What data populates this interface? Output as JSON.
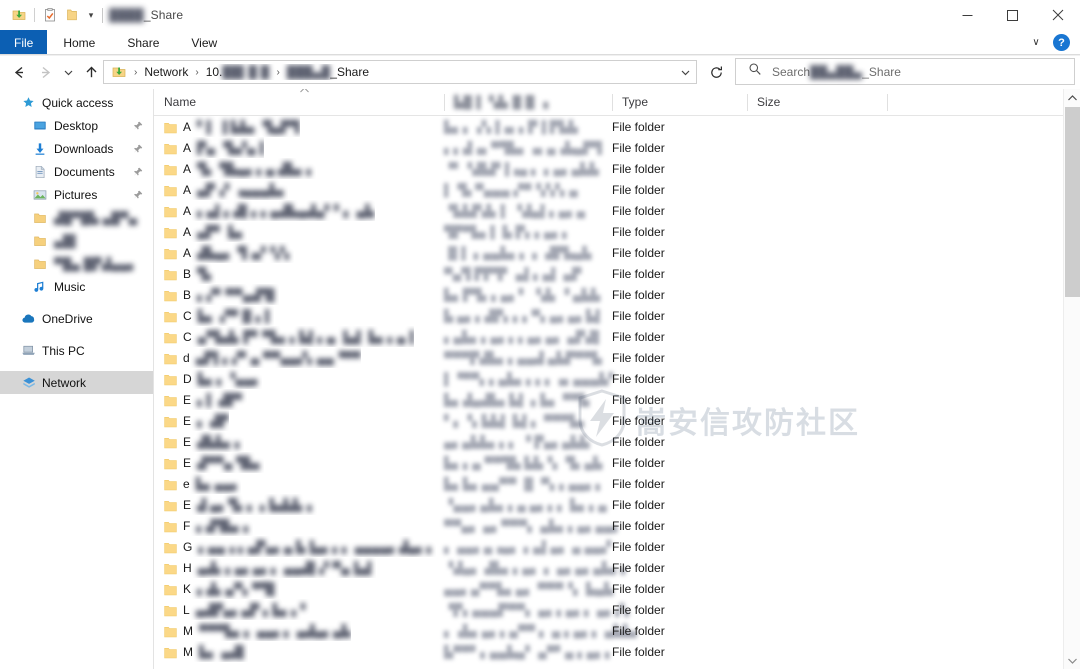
{
  "window": {
    "title_blurred": "████",
    "title_suffix": "_Share",
    "quick_access_toolbar": [
      {
        "name": "folder-download-icon",
        "label": ""
      },
      {
        "name": "properties-icon",
        "label": ""
      },
      {
        "name": "new-folder-icon",
        "label": ""
      },
      {
        "name": "customize-caret-icon",
        "label": "▾"
      }
    ],
    "controls": {
      "minimize": "—",
      "maximize": "□",
      "close": "✕"
    }
  },
  "ribbon": {
    "tabs": [
      {
        "label": "File",
        "active": true
      },
      {
        "label": "Home",
        "active": false
      },
      {
        "label": "Share",
        "active": false
      },
      {
        "label": "View",
        "active": false
      }
    ],
    "expand_caret": "∨",
    "help_label": "?"
  },
  "navbar": {
    "back": "←",
    "forward": "→",
    "recent_caret": "∨",
    "up": "↑",
    "address_caret": "∨",
    "refresh": "↻",
    "breadcrumbs": [
      {
        "label": "",
        "icon": "folder-download-icon",
        "blurred": false
      },
      {
        "label": "Network",
        "blurred": false
      },
      {
        "label": "10.",
        "blurred_tail": "██▌█ █",
        "blurred": true
      },
      {
        "label": "_Share",
        "blurred_head": "███▄█",
        "blurred": true
      }
    ],
    "separator": "›"
  },
  "search": {
    "icon": "search-icon",
    "placeholder_prefix": "Search ",
    "placeholder_blurred": "██▄██▄",
    "placeholder_suffix": "_Share"
  },
  "sidebar": {
    "items": [
      {
        "label": "Quick access",
        "icon": "pin-star-icon",
        "level": "root",
        "pinned": false,
        "selected": false,
        "blurred": false
      },
      {
        "label": "Desktop",
        "icon": "desktop-icon",
        "level": "child",
        "pinned": true,
        "selected": false,
        "blurred": false
      },
      {
        "label": "Downloads",
        "icon": "downloads-icon",
        "level": "child",
        "pinned": true,
        "selected": false,
        "blurred": false
      },
      {
        "label": "Documents",
        "icon": "documents-icon",
        "level": "child",
        "pinned": true,
        "selected": false,
        "blurred": false
      },
      {
        "label": "Pictures",
        "icon": "pictures-icon",
        "level": "child",
        "pinned": true,
        "selected": false,
        "blurred": false
      },
      {
        "label": "▟█▀█▙ ▄█▀▄",
        "icon": "folder-icon",
        "level": "child",
        "pinned": false,
        "selected": false,
        "blurred": true
      },
      {
        "label": "▄█▌",
        "icon": "folder-icon",
        "level": "child",
        "pinned": false,
        "selected": false,
        "blurred": true
      },
      {
        "label": "▀█▄ █▛▟▄▄▖",
        "icon": "folder-icon",
        "level": "child",
        "pinned": false,
        "selected": false,
        "blurred": true
      },
      {
        "label": "Music",
        "icon": "music-icon",
        "level": "child",
        "pinned": false,
        "selected": false,
        "blurred": false
      },
      {
        "label": "OneDrive",
        "icon": "onedrive-icon",
        "level": "root",
        "pinned": false,
        "selected": false,
        "blurred": false,
        "gap_before": true
      },
      {
        "label": "This PC",
        "icon": "thispc-icon",
        "level": "root",
        "pinned": false,
        "selected": false,
        "blurred": false,
        "gap_before": true
      },
      {
        "label": "Network",
        "icon": "network-icon",
        "level": "root",
        "pinned": false,
        "selected": true,
        "blurred": false,
        "gap_before": true
      }
    ]
  },
  "file_list": {
    "columns": [
      {
        "label": "Name",
        "blurred": false,
        "sorted": "asc"
      },
      {
        "label": "▙█▐ ▝▟▖█▐▌▗",
        "blurred": true,
        "sorted": ""
      },
      {
        "label": "Type",
        "blurred": false,
        "sorted": ""
      },
      {
        "label": "Size",
        "blurred": false,
        "sorted": ""
      }
    ],
    "type_value": "File folder",
    "rows": [
      {
        "name_visible": "A",
        "name_blurred": "▘▌ ▐ ▙▙▖ ▜▄▛▜",
        "date_blurred": "▙▖▖▗▚▐▗▖▖▛▐ ▛▙▙"
      },
      {
        "name_visible": "A",
        "name_blurred": "▛▄ ▝▙▞▄▐"
      },
      {
        "name_visible": "A",
        "name_blurred": "▜▖ ▜▙▄▖▖▄ ▟▙▖▖"
      },
      {
        "name_visible": "A",
        "name_blurred": "▄▛▗▘▗▄▄▄▙▖"
      },
      {
        "name_visible": "A",
        "name_blurred": "▖▄▌▖▟▌▖▖▄▟▙▄▟▄▘▘▖ ▄▙"
      },
      {
        "name_visible": "A",
        "name_blurred": "▄▛▘ ▙▖"
      },
      {
        "name_visible": "A",
        "name_blurred": "▟▙▄▖ ▜▗▞▝▞▖"
      },
      {
        "name_visible": "B",
        "name_blurred": "▜▖"
      },
      {
        "name_visible": "B",
        "name_blurred": "▖▞▘▀▀▄▟▜▌"
      },
      {
        "name_visible": "C",
        "name_blurred": "▙▖ ▞▀▐▌▖▌"
      },
      {
        "name_visible": "C",
        "name_blurred": "▄▀▙▟▖▛▘▀▙▖▖▙▌▖▄ ▐▄▌ ▙▖▖▄▐"
      },
      {
        "name_visible": "d",
        "name_blurred": "▄▛▌▖▞▘▄ ▀▀▄▄▞▖▄▄▝▀▀"
      },
      {
        "name_visible": "D",
        "name_blurred": "▙▖▖▝▄▄▖"
      },
      {
        "name_visible": "E",
        "name_blurred": "▖▌ ▟▛▘"
      },
      {
        "name_visible": "E",
        "name_blurred": " ▖ ▟▛"
      },
      {
        "name_visible": "E",
        "name_blurred": "▟▙▙▖▖"
      },
      {
        "name_visible": "E",
        "name_blurred": "▟▀▀▄ ▜▙▖"
      },
      {
        "name_visible": "e",
        "name_blurred": "▙▖▄▄▖"
      },
      {
        "name_visible": "E",
        "name_blurred": "▟ ▄▖▜▖▖ ▖▙▟▟▖▖"
      },
      {
        "name_visible": "F",
        "name_blurred": "▖▟▜▙▖▖"
      },
      {
        "name_visible": "G",
        "name_blurred": "▖▄▄▗ ▖▄▛▄▖▄ ▙▐▄▖▖▖ ▄▄▄▄▖▟▄▖▖"
      },
      {
        "name_visible": "H",
        "name_blurred": "▄▟▖▖▄▖▄▖▖ ▄▄▟▌▞ ▀▄▐▄▌"
      },
      {
        "name_visible": "K",
        "name_blurred": "▖▟▖▄▀▖▀▜▌"
      },
      {
        "name_visible": "L",
        "name_blurred": "▄▟▛▄▖▄▛ ▖▙▖▖▘"
      },
      {
        "name_visible": "M",
        "name_blurred": "▀▀▀▙▖▖ ▄▄▖▖ ▄▟▄▖▄▙"
      },
      {
        "name_visible": "M",
        "name_blurred": "▙▖ ▄▟▌"
      }
    ],
    "row_dates": [
      "▙▖▖▗▚▐▗▖▖▛▐ ▛▙▙",
      "▖▖▟▗▖▀▜▙▖▗▖▄▗▙▄▛▜",
      "▝▘▝▟▙▛▐▗▄ ▖ ▖▄▖▄▙▙",
      "▌▝▙ ▀▄▄▄ ▞▀▝▞▞▖▄",
      "▝▙▙▛▟▖▌ ▝▟▄▌▖▄▖▄",
      "▜▛▀▙▖▌ ▙ ▛▖▖▄▖▖",
      "▐▌▌ ▖▄▄▙▖▖ ▖ ▟▛▙▄▙",
      "▀▄▜ ▛▛▜▘ ▄▌▖▄▌ ▄▛",
      "▙▖▛▜▖▖▄▖▘ ▝▟▖▝ ▄▙▙",
      "▙ ▄▖▖▟▛▖▖▖▀▖▄▖▄▖▙▌",
      "▖▄▙▖▖▄▖▖▖▄▖▄▖ ▄▛▟▌",
      "▀▀▀▛▟▙▖▖▄▄▟ ▄▙▛▀▀▙",
      "▌▝▀▀▖▖▄▙▖▖▖▖▗▖▄▄▄▙▘",
      "▙▖▟▄▟▙▖▙▌ ▖▙▖ ▀▀▙",
      "▘▖▝▖▙▙▌ ▙▌▖ ▀▀▀▙▖",
      "▄▖▄▙▙▖▖▖ ▝ ▛▄▖▄▙▙",
      "▙▖▖▄ ▀▀▜▙ ▙▙▝▖ ▜▖▄▙",
      "▙▖▙▖▄▄▀▀ ▐▌ ▀▖▖▄▄▖▖",
      "▝▄▄▖▄▙▖▖▄ ▄▖▖▖ ▙▖▖▄",
      "▀▀▄▖ ▄▖▀▀▀▖ ▄▙▖▖▄▖▄▄▖",
      "▖ ▄▄▖▄▗▄▖ ▖▄▌▄▖ ▄ ▄▄▞",
      "▝▟▄▖ ▟▙▖▖▄▖ ▖ ▄▖▄▖▄▙▖▖",
      "▄▄▖▄▀▀▙▖▄▖ ▀▀▀▝▖ ▙▄▙",
      "▝▛▖▄▄▄▛▀▀▖ ▄▖▖▄▖▖ ▄▖▞▖",
      "▖▗▙▖▄▖▖▄▀▀ ▖ ▄ ▖▄▖▖ ▄▙▙▖",
      "▙▀▀▘▖▄▄▙▄▘ ▄▀▘▄ ▖▄▖▖"
    ]
  },
  "watermark": {
    "text": "嵩安信攻防社区",
    "logo": "shield-bolt-icon"
  },
  "scrollbar": {
    "up_arrow": "∧",
    "down_arrow": "∨"
  }
}
